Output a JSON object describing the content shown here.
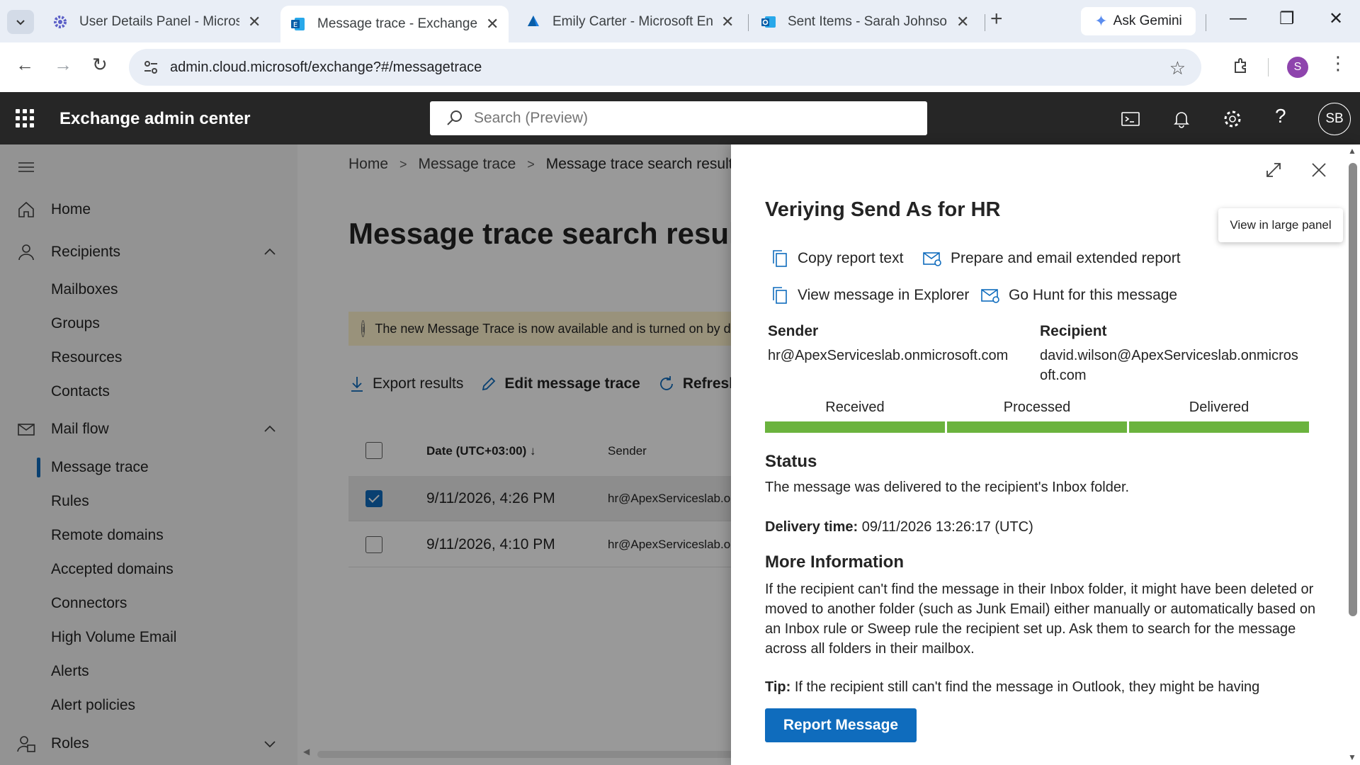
{
  "browser": {
    "tabs": [
      {
        "title": "User Details Panel - Microsoft",
        "close": "✕"
      },
      {
        "title": "Message trace - Exchange admin",
        "close": "✕"
      },
      {
        "title": "Emily Carter - Microsoft Entra",
        "close": "✕"
      },
      {
        "title": "Sent Items - Sarah Johnson -",
        "close": "✕"
      }
    ],
    "new_tab": "+",
    "gemini_label": "Ask Gemini",
    "url": "admin.cloud.microsoft/exchange?#/messagetrace",
    "profile_initial": "S"
  },
  "app": {
    "name": "Exchange admin center",
    "search_placeholder": "Search (Preview)",
    "user_initials": "SB"
  },
  "nav": {
    "home": "Home",
    "recipients": "Recipients",
    "recipients_items": [
      "Mailboxes",
      "Groups",
      "Resources",
      "Contacts"
    ],
    "mailflow": "Mail flow",
    "mailflow_items": [
      "Message trace",
      "Rules",
      "Remote domains",
      "Accepted domains",
      "Connectors",
      "High Volume Email",
      "Alerts",
      "Alert policies"
    ],
    "roles": "Roles"
  },
  "main": {
    "breadcrumbs": [
      "Home",
      "Message trace",
      "Message trace search results"
    ],
    "title": "Message trace search results",
    "banner": "The new Message Trace is now available and is turned on by default",
    "commands": {
      "export": "Export results",
      "edit": "Edit message trace",
      "refresh": "Refresh"
    },
    "columns": {
      "date": "Date (UTC+03:00)",
      "sender": "Sender"
    },
    "rows": [
      {
        "date": "9/11/2026, 4:26 PM",
        "sender": "hr@ApexServiceslab.onmicrosoft.com",
        "selected": true
      },
      {
        "date": "9/11/2026, 4:10 PM",
        "sender": "hr@ApexServiceslab.onmicrosoft.com",
        "selected": false
      }
    ]
  },
  "panel": {
    "title": "Veriying Send As for HR",
    "tooltip": "View in large panel",
    "actions": {
      "copy": "Copy report text",
      "prepare": "Prepare and email extended report",
      "explorer": "View message in Explorer",
      "hunt": "Go Hunt for this message"
    },
    "sender_label": "Sender",
    "sender": "hr@ApexServiceslab.onmicrosoft.com",
    "recipient_label": "Recipient",
    "recipient_line1": "david.wilson@ApexServiceslab.onmicros",
    "recipient_line2": "oft.com",
    "stages": [
      "Received",
      "Processed",
      "Delivered"
    ],
    "status_h": "Status",
    "status_text": "The message was delivered to the recipient's Inbox folder.",
    "delivery_label": "Delivery time:",
    "delivery_value": "09/11/2026 13:26:17 (UTC)",
    "more_h": "More Information",
    "more_text": "If the recipient can't find the message in their Inbox folder, it might have been deleted or moved to another folder (such as Junk Email) either manually or automatically based on an Inbox rule or Sweep rule the recipient set up. Ask them to search for the message across all folders in their mailbox.",
    "tip_label": "Tip:",
    "tip_text": "If the recipient still can't find the message in Outlook, they might be having",
    "report_button": "Report Message"
  },
  "colors": {
    "accent": "#0f6cbd",
    "header": "#262626",
    "progress": "#6bb33e",
    "banner": "#fff4ce"
  }
}
